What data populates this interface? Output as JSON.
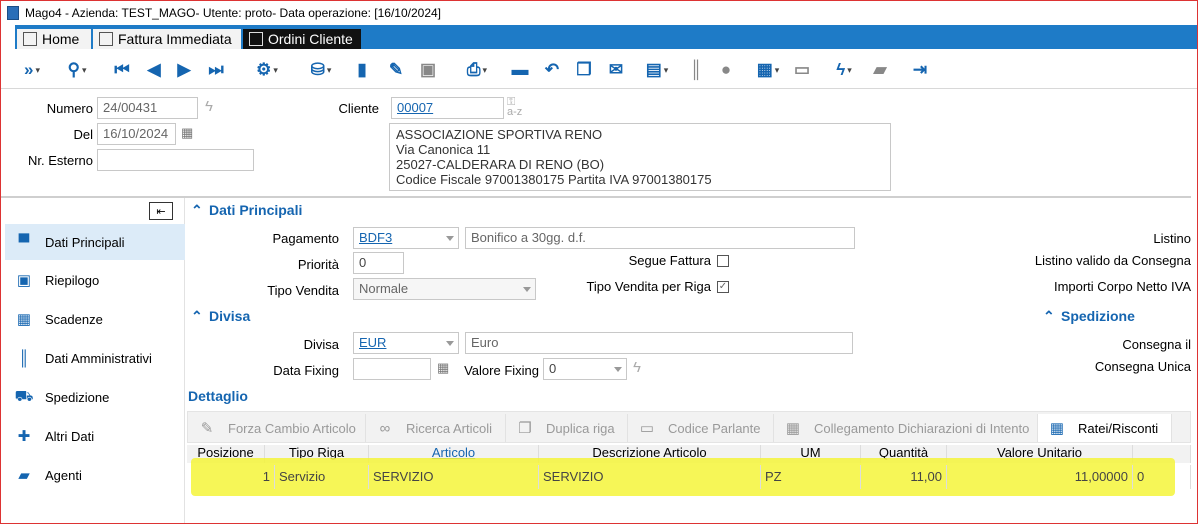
{
  "window": {
    "title": "Mago4 - Azienda: TEST_MAGO- Utente: proto- Data operazione: [16/10/2024]"
  },
  "tabs": [
    {
      "label": "Home"
    },
    {
      "label": "Fattura Immediata"
    },
    {
      "label": "Ordini Cliente"
    }
  ],
  "toolbar": {
    "icons": [
      "expand-icon",
      "search-icon",
      "first-icon",
      "prev-icon",
      "next-icon",
      "last-icon",
      "settings-icon",
      "database-icon",
      "new-icon",
      "edit-icon",
      "save-icon",
      "print-icon",
      "delete-icon",
      "undo-icon",
      "copy-icon",
      "mail-icon",
      "report-icon",
      "barcode-icon",
      "user-icon",
      "grid-icon",
      "calendar-icon",
      "lightning-icon",
      "briefcase-icon",
      "exit-icon"
    ]
  },
  "header": {
    "numero_label": "Numero",
    "numero_value": "24/00431",
    "del_label": "Del",
    "del_value": "16/10/2024",
    "esterno_label": "Nr. Esterno",
    "esterno_value": "",
    "cliente_label": "Cliente",
    "cliente_value": "00007",
    "address": [
      "ASSOCIAZIONE SPORTIVA RENO",
      "Via Canonica 11",
      "25027-CALDERARA DI RENO (BO)",
      "Codice Fiscale 97001380175 Partita IVA 97001380175"
    ]
  },
  "sidebar": {
    "items": [
      {
        "label": "Dati Principali"
      },
      {
        "label": "Riepilogo"
      },
      {
        "label": "Scadenze"
      },
      {
        "label": "Dati Amministrativi"
      },
      {
        "label": "Spedizione"
      },
      {
        "label": "Altri Dati"
      },
      {
        "label": "Agenti"
      }
    ]
  },
  "main": {
    "dati_principali_title": "Dati Principali",
    "pagamento_label": "Pagamento",
    "pagamento_code": "BDF3",
    "pagamento_desc": "Bonifico a 30gg. d.f.",
    "priorita_label": "Priorità",
    "priorita_value": "0",
    "tipo_vendita_label": "Tipo Vendita",
    "tipo_vendita_value": "Normale",
    "segue_fattura_label": "Segue Fattura",
    "tipo_vendita_riga_label": "Tipo Vendita per Riga",
    "listino_label": "Listino",
    "listino_valido_label": "Listino valido da Consegna",
    "importi_label": "Importi Corpo Netto IVA",
    "divisa_title": "Divisa",
    "divisa_label": "Divisa",
    "divisa_code": "EUR",
    "divisa_desc": "Euro",
    "data_fixing_label": "Data Fixing",
    "data_fixing_value": "",
    "valore_fixing_label": "Valore Fixing",
    "valore_fixing_value": "0",
    "spedizione_title": "Spedizione",
    "consegna_il_label": "Consegna il",
    "consegna_unica_label": "Consegna Unica",
    "dettaglio_title": "Dettaglio"
  },
  "detail_toolbar": [
    {
      "label": "Forza Cambio Articolo"
    },
    {
      "label": "Ricerca Articoli"
    },
    {
      "label": "Duplica riga"
    },
    {
      "label": "Codice Parlante"
    },
    {
      "label": "Collegamento Dichiarazioni di Intento"
    },
    {
      "label": "Ratei/Risconti"
    }
  ],
  "grid": {
    "headers": [
      "Posizione",
      "Tipo Riga",
      "Articolo",
      "Descrizione Articolo",
      "UM",
      "Quantità",
      "Valore Unitario"
    ],
    "row": [
      "1",
      "Servizio",
      "SERVIZIO",
      "SERVIZIO",
      "PZ",
      "11,00",
      "11,00000",
      "0"
    ]
  },
  "colors": {
    "accent": "#1565b0",
    "tabbar": "#1e7bc7",
    "highlight": "#f5f53a"
  }
}
